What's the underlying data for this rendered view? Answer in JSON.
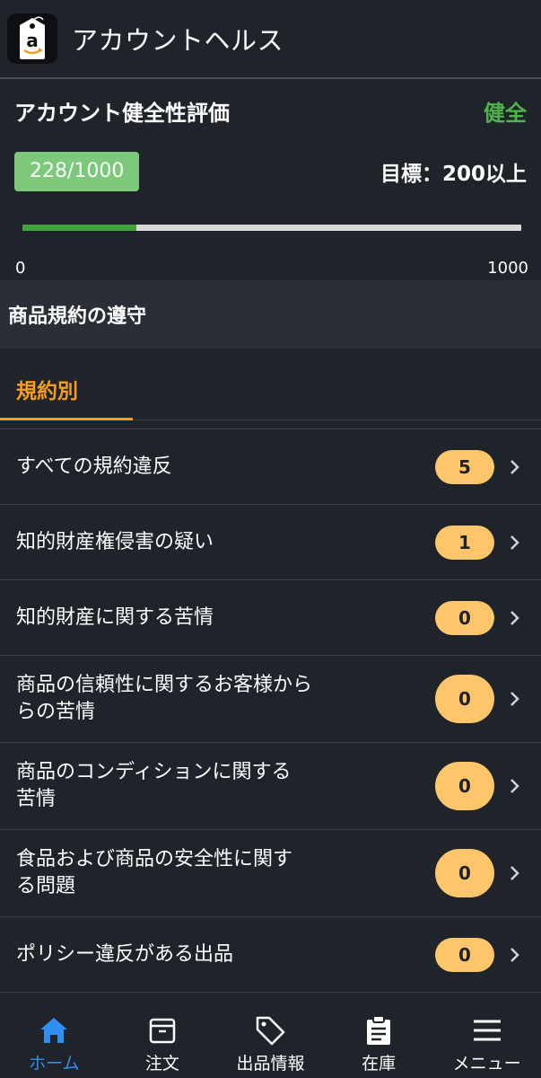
{
  "header": {
    "title": "アカウントヘルス",
    "app_icon": "amazon-seller-tag-icon"
  },
  "score": {
    "title": "アカウント健全性評価",
    "status": "健全",
    "value_text": "228/1000",
    "value": 228,
    "max": 1000,
    "target_text": "目標：200以上",
    "min_label": "0",
    "max_label": "1000"
  },
  "section": {
    "title": "商品規約の遵守"
  },
  "tab": {
    "label": "規約別"
  },
  "items": [
    {
      "label": "すべての規約違反",
      "count": "5"
    },
    {
      "label": "知的財産権侵害の疑い",
      "count": "1"
    },
    {
      "label": "知的財産に関する苦情",
      "count": "0"
    },
    {
      "label": "商品の信頼性に関するお客様から\nらの苦情",
      "count": "0"
    },
    {
      "label": "商品のコンディションに関する\n苦情",
      "count": "0"
    },
    {
      "label": "食品および商品の安全性に関す\nる問題",
      "count": "0"
    },
    {
      "label": "ポリシー違反がある出品",
      "count": "0"
    }
  ],
  "nav": [
    {
      "label": "ホーム",
      "icon": "home-icon",
      "active": true
    },
    {
      "label": "注文",
      "icon": "box-icon",
      "active": false
    },
    {
      "label": "出品情報",
      "icon": "tag-icon",
      "active": false
    },
    {
      "label": "在庫",
      "icon": "clipboard-icon",
      "active": false
    },
    {
      "label": "メニュー",
      "icon": "menu-icon",
      "active": false
    }
  ],
  "colors": {
    "accent": "#f39c1f",
    "healthy": "#4fb34c",
    "badge": "#fec66a",
    "nav_active": "#2f8ff0"
  }
}
